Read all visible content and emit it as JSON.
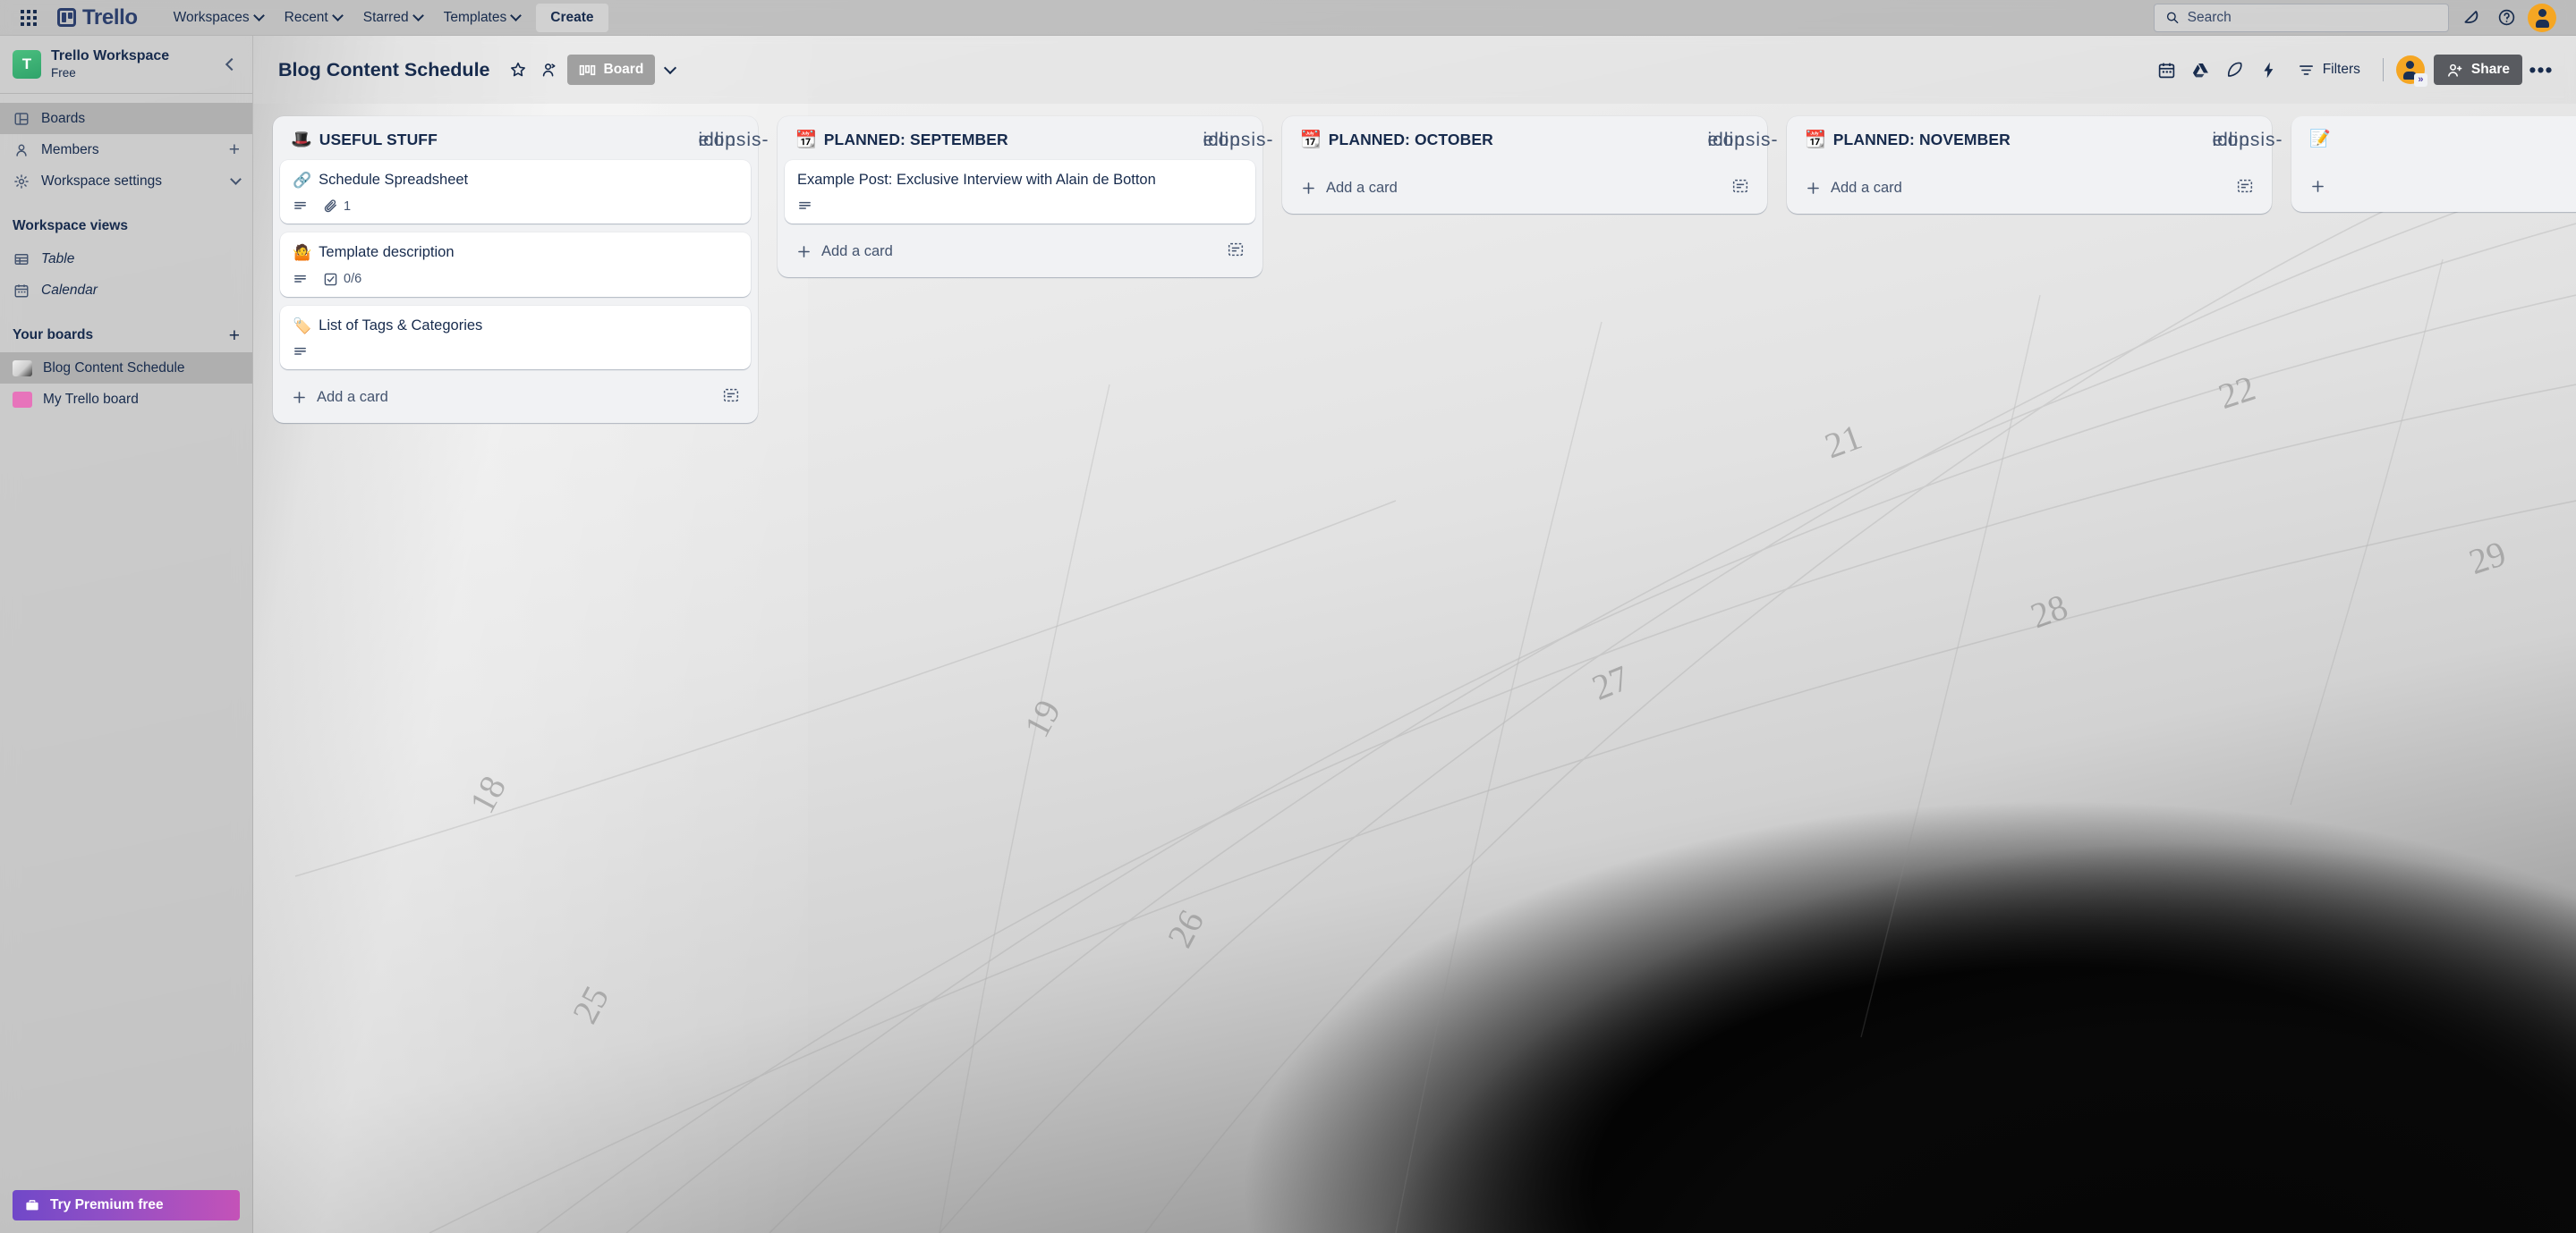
{
  "topnav": {
    "app_switcher_label": "app-switcher",
    "logo_text": "Trello",
    "items": [
      {
        "label": "Workspaces",
        "has_chevron": true
      },
      {
        "label": "Recent",
        "has_chevron": true
      },
      {
        "label": "Starred",
        "has_chevron": true
      },
      {
        "label": "Templates",
        "has_chevron": true
      }
    ],
    "create_label": "Create",
    "search_placeholder": "Search",
    "search_value": "",
    "notifications_icon": "bell-icon",
    "help_icon": "question-circle-icon",
    "account_icon": "avatar"
  },
  "sidebar": {
    "workspace_name": "Trello Workspace",
    "workspace_plan": "Free",
    "workspace_initial": "T",
    "collapse_label": "collapse-sidebar",
    "nav": [
      {
        "label": "Boards",
        "icon": "board-icon",
        "trailing": ""
      },
      {
        "label": "Members",
        "icon": "person-icon",
        "trailing": "+"
      },
      {
        "label": "Workspace settings",
        "icon": "gear-icon",
        "trailing": "v"
      }
    ],
    "views_heading": "Workspace views",
    "views": [
      {
        "label": "Table",
        "icon": "table-icon"
      },
      {
        "label": "Calendar",
        "icon": "calendar-icon"
      }
    ],
    "boards_heading": "Your boards",
    "boards_add_label": "+",
    "boards": [
      {
        "label": "Blog Content Schedule",
        "active": true,
        "color": "#d8d8d8"
      },
      {
        "label": "My Trello board",
        "active": false,
        "color": "#e774bb"
      }
    ],
    "premium_label": "Try Premium free",
    "premium_icon": "briefcase-icon",
    "premium_gradient_from": "#7048c8",
    "premium_gradient_to": "#c452b8"
  },
  "board_header": {
    "title": "Blog Content Schedule",
    "star_icon": "star-icon",
    "visibility_icon": "workspace-visible-icon",
    "view_label": "Board",
    "view_icon": "board-view-icon",
    "view_chevron": "chevron-down-icon",
    "actions": [
      {
        "icon": "calendar-power-up-icon",
        "name": "calendar-power-up"
      },
      {
        "icon": "google-drive-icon",
        "name": "google-drive-power-up"
      },
      {
        "icon": "rocket-icon",
        "name": "power-ups"
      },
      {
        "icon": "automation-bolt-icon",
        "name": "automation"
      }
    ],
    "filters_label": "Filters",
    "filters_icon": "filter-icon",
    "share_label": "Share",
    "share_icon": "person-add-icon",
    "premium_badge": "»",
    "more_icon": "ellipsis-icon"
  },
  "lists": [
    {
      "emoji": "🎩",
      "title": "USEFUL STUFF",
      "menu_icon": "ellipsis-icon",
      "add_card_label": "Add a card",
      "template_icon": "card-template-icon",
      "cards": [
        {
          "emoji": "🔗",
          "title": "Schedule Spreadsheet",
          "badges": [
            {
              "type": "description",
              "icon": "description-icon",
              "value": ""
            },
            {
              "type": "attachment",
              "icon": "paperclip-icon",
              "value": "1"
            }
          ]
        },
        {
          "emoji": "🤷",
          "title": "Template description",
          "badges": [
            {
              "type": "description",
              "icon": "description-icon",
              "value": ""
            },
            {
              "type": "checklist",
              "icon": "checkbox-icon",
              "value": "0/6"
            }
          ]
        },
        {
          "emoji": "🏷️",
          "title": "List of Tags & Categories",
          "badges": [
            {
              "type": "description",
              "icon": "description-icon",
              "value": ""
            }
          ]
        }
      ]
    },
    {
      "emoji": "📆",
      "title": "PLANNED: SEPTEMBER",
      "menu_icon": "ellipsis-icon",
      "add_card_label": "Add a card",
      "template_icon": "card-template-icon",
      "cards": [
        {
          "emoji": "",
          "title": "Example Post: Exclusive Interview with Alain de Botton",
          "badges": [
            {
              "type": "description",
              "icon": "description-icon",
              "value": ""
            }
          ]
        }
      ]
    },
    {
      "emoji": "📆",
      "title": "PLANNED: OCTOBER",
      "menu_icon": "ellipsis-icon",
      "add_card_label": "Add a card",
      "template_icon": "card-template-icon",
      "cards": []
    },
    {
      "emoji": "📆",
      "title": "PLANNED: NOVEMBER",
      "menu_icon": "ellipsis-icon",
      "add_card_label": "Add a card",
      "template_icon": "card-template-icon",
      "cards": []
    }
  ],
  "list_peek": {
    "emoji": "📝",
    "add_card_label": "+"
  },
  "background": {
    "description": "open notebook calendar page photo",
    "visible_numbers": [
      "22",
      "21",
      "29",
      "28",
      "27",
      "19",
      "26",
      "25",
      "18"
    ]
  }
}
